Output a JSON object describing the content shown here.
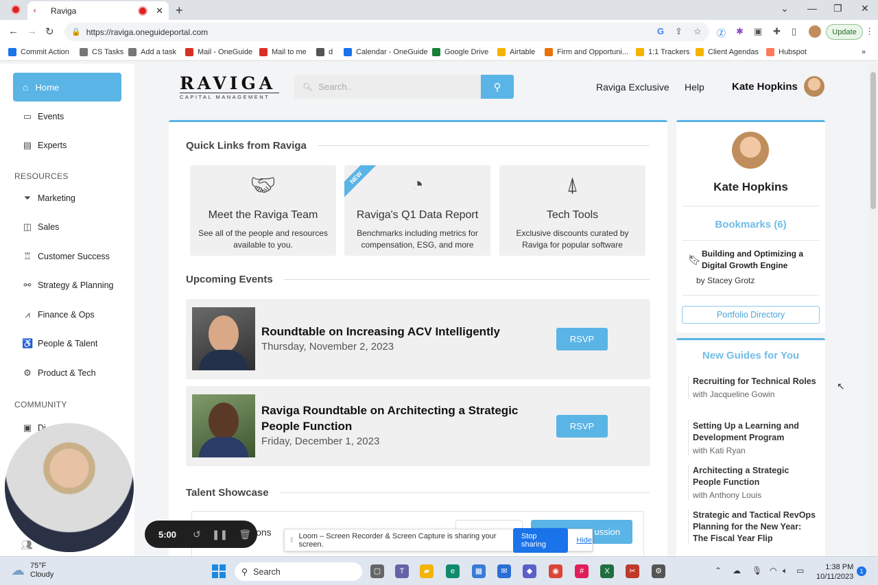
{
  "browser": {
    "tab_title": "Raviga",
    "url": "https://raviga.oneguideportal.com",
    "update_label": "Update",
    "bookmarks": [
      {
        "label": "Commit Action",
        "color": "#1a73e8"
      },
      {
        "label": "CS Tasks",
        "color": "#777"
      },
      {
        "label": "Add a task",
        "color": "#777"
      },
      {
        "label": "Mail - OneGuide",
        "color": "#d93025"
      },
      {
        "label": "Mail to me",
        "color": "#d93025"
      },
      {
        "label": "d",
        "color": "#555"
      },
      {
        "label": "Calendar - OneGuide",
        "color": "#1a73e8"
      },
      {
        "label": "Google Drive",
        "color": "#188038"
      },
      {
        "label": "Airtable",
        "color": "#f4b400"
      },
      {
        "label": "Firm and Opportuni...",
        "color": "#e8710a"
      },
      {
        "label": "1:1 Trackers",
        "color": "#f4b400"
      },
      {
        "label": "Client Agendas",
        "color": "#f4b400"
      },
      {
        "label": "Hubspot",
        "color": "#ff7a59"
      }
    ]
  },
  "sidebar": {
    "home": "Home",
    "items": [
      {
        "label": "Events",
        "icon": "calendar-icon"
      },
      {
        "label": "Experts",
        "icon": "id-card-icon"
      }
    ],
    "resources_head": "RESOURCES",
    "resources": [
      {
        "label": "Marketing",
        "icon": "funnel-icon"
      },
      {
        "label": "Sales",
        "icon": "chat-icon"
      },
      {
        "label": "Customer Success",
        "icon": "trophy-icon"
      },
      {
        "label": "Strategy & Planning",
        "icon": "route-icon"
      },
      {
        "label": "Finance & Ops",
        "icon": "chart-hand-icon"
      },
      {
        "label": "People & Talent",
        "icon": "people-icon"
      },
      {
        "label": "Product & Tech",
        "icon": "gear-icon"
      }
    ],
    "community_head": "COMMUNITY",
    "community": [
      {
        "label": "Di",
        "icon": "directory-icon"
      }
    ]
  },
  "header": {
    "logo_main": "RAVIGA",
    "logo_sub": "CAPITAL MANAGEMENT",
    "search_placeholder": "Search..",
    "link_exclusive": "Raviga Exclusive",
    "link_help": "Help",
    "user_name": "Kate Hopkins"
  },
  "quick_links": {
    "title": "Quick Links from Raviga",
    "items": [
      {
        "title": "Meet the Raviga Team",
        "desc": "See all of the people and resources available to you.",
        "icon": "handshake-icon"
      },
      {
        "title": "Raviga's Q1 Data Report",
        "desc": "Benchmarks including metrics for compensation, ESG, and more",
        "icon": "pie-chart-icon",
        "ribbon": "NEW"
      },
      {
        "title": "Tech Tools",
        "desc": "Exclusive discounts curated by Raviga for popular software",
        "icon": "rocket-icon"
      }
    ]
  },
  "events": {
    "title": "Upcoming Events",
    "items": [
      {
        "title": "Roundtable on Increasing ACV Intelligently",
        "date": "Thursday, November 2, 2023",
        "rsvp": "RSVP"
      },
      {
        "title": "Raviga Roundtable on Architecting a Strategic People Function",
        "date": "Friday, December 1, 2023",
        "rsvp": "RSVP"
      }
    ]
  },
  "talent": {
    "title": "Talent Showcase",
    "card_text": "ions",
    "button": "ussion"
  },
  "profile": {
    "name": "Kate Hopkins",
    "bookmarks_head": "Bookmarks (6)",
    "bookmark_title": "Building and Optimizing a Digital Growth Engine",
    "bookmark_author": "by Stacey Grotz",
    "directory_button": "Portfolio Directory"
  },
  "guides": {
    "title": "New Guides for You",
    "items": [
      {
        "title": "Recruiting for Technical Roles",
        "author": "with Jacqueline Gowin"
      },
      {
        "title": "Setting Up a Learning and Development Program",
        "author": "with Kati Ryan"
      },
      {
        "title": "Architecting a Strategic People Function",
        "author": "with Anthony Louis"
      },
      {
        "title": "Strategic and Tactical RevOps Planning for the New Year: The Fiscal Year Flip",
        "author": ""
      }
    ]
  },
  "loom": {
    "timer": "5:00",
    "share_text": "Loom – Screen Recorder & Screen Capture is sharing your screen.",
    "stop_label": "Stop sharing",
    "hide_label": "Hide"
  },
  "taskbar": {
    "temp": "75°F",
    "condition": "Cloudy",
    "search": "Search",
    "time": "1:38 PM",
    "date": "10/11/2023",
    "notifications": "1"
  }
}
